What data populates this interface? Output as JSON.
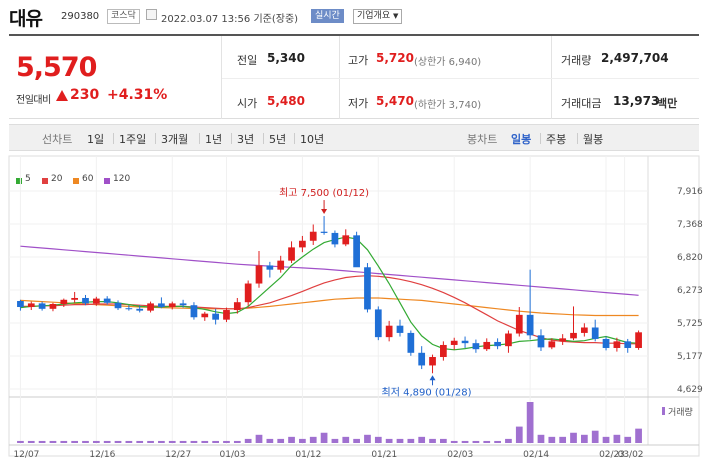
{
  "header": {
    "name": "대유",
    "code": "290380",
    "market": "코스닥",
    "datetime": "2022.03.07 13:56",
    "basis": "기준(장중)",
    "live_label": "실시간",
    "overview_label": "기업개요"
  },
  "quote": {
    "price": "5,570",
    "change_label": "전일대비",
    "change_value": "230",
    "change_pct": "+4.31%",
    "stats": {
      "prev_close": {
        "label": "전일",
        "value": "5,340"
      },
      "open": {
        "label": "시가",
        "value": "5,480"
      },
      "high": {
        "label": "고가",
        "value": "5,720",
        "sub": "(상한가 6,940)"
      },
      "low": {
        "label": "저가",
        "value": "5,470",
        "sub": "(하한가 3,740)"
      },
      "volume": {
        "label": "거래량",
        "value": "2,497,704"
      },
      "amount": {
        "label": "거래대금",
        "value": "13,973",
        "unit": "백만"
      }
    }
  },
  "period_bar": {
    "line_label": "선차트",
    "line_items": [
      "1일",
      "1주일",
      "3개월",
      "1년",
      "3년",
      "5년",
      "10년"
    ],
    "candle_label": "봉차트",
    "candle_items": [
      "일봉",
      "주봉",
      "월봉"
    ],
    "active_candle": "일봉"
  },
  "colors": {
    "up": "#e01e1e",
    "down": "#1f6fd6",
    "ma5": "#33aa33",
    "ma20": "#e04040",
    "ma60": "#ee8822",
    "ma120": "#a050c8",
    "volume": "#a070d0",
    "accent": "#2f63c9"
  },
  "chart_data": {
    "type": "candlestick",
    "legend": [
      "5",
      "20",
      "60",
      "120"
    ],
    "y_ticks": [
      "7,916",
      "7,368",
      "6,820",
      "6,273",
      "5,725",
      "5,177",
      "4,629"
    ],
    "ylim": [
      4629,
      7916
    ],
    "x_ticks": [
      "12/07",
      "12/16",
      "12/27",
      "01/03",
      "01/12",
      "01/21",
      "02/03",
      "02/14",
      "02/23",
      "03/02"
    ],
    "volume_label": "거래량",
    "annotations": {
      "high": {
        "text": "최고 7,500 (01/12)",
        "value": 7500
      },
      "low": {
        "text": "최저 4,890 (01/28)",
        "value": 4890
      }
    },
    "candles": [
      [
        6090,
        6110,
        5930,
        5990
      ],
      [
        5990,
        6080,
        5940,
        6050
      ],
      [
        6050,
        6080,
        5930,
        5960
      ],
      [
        5960,
        6060,
        5920,
        6040
      ],
      [
        6040,
        6130,
        5990,
        6110
      ],
      [
        6110,
        6240,
        6060,
        6140
      ],
      [
        6140,
        6190,
        6020,
        6050
      ],
      [
        6050,
        6160,
        6010,
        6130
      ],
      [
        6130,
        6170,
        6030,
        6060
      ],
      [
        6060,
        6100,
        5940,
        5970
      ],
      [
        5970,
        6020,
        5930,
        5960
      ],
      [
        5960,
        6020,
        5900,
        5930
      ],
      [
        5930,
        6080,
        5900,
        6050
      ],
      [
        6050,
        6150,
        5970,
        5990
      ],
      [
        5990,
        6080,
        5950,
        6050
      ],
      [
        6050,
        6110,
        5980,
        6020
      ],
      [
        6020,
        6070,
        5780,
        5820
      ],
      [
        5820,
        5910,
        5760,
        5880
      ],
      [
        5880,
        5960,
        5700,
        5780
      ],
      [
        5780,
        5980,
        5740,
        5940
      ],
      [
        5940,
        6140,
        5880,
        6070
      ],
      [
        6070,
        6430,
        6010,
        6380
      ],
      [
        6380,
        6920,
        6310,
        6680
      ],
      [
        6680,
        6740,
        6480,
        6610
      ],
      [
        6610,
        6840,
        6560,
        6760
      ],
      [
        6760,
        7080,
        6720,
        6980
      ],
      [
        6980,
        7170,
        6900,
        7090
      ],
      [
        7090,
        7360,
        7020,
        7240
      ],
      [
        7240,
        7500,
        7190,
        7220
      ],
      [
        7220,
        7260,
        6980,
        7030
      ],
      [
        7030,
        7280,
        7000,
        7180
      ],
      [
        7180,
        7240,
        6990,
        6650
      ],
      [
        6650,
        6720,
        5900,
        5950
      ],
      [
        5950,
        6000,
        5440,
        5490
      ],
      [
        5490,
        5760,
        5420,
        5680
      ],
      [
        5680,
        5780,
        5500,
        5560
      ],
      [
        5560,
        5600,
        5180,
        5230
      ],
      [
        5230,
        5340,
        4960,
        5020
      ],
      [
        5020,
        5200,
        4890,
        5160
      ],
      [
        5160,
        5420,
        5100,
        5360
      ],
      [
        5360,
        5480,
        5280,
        5430
      ],
      [
        5430,
        5500,
        5310,
        5390
      ],
      [
        5390,
        5450,
        5230,
        5290
      ],
      [
        5290,
        5470,
        5260,
        5410
      ],
      [
        5410,
        5470,
        5290,
        5340
      ],
      [
        5340,
        5600,
        5230,
        5550
      ],
      [
        5550,
        5990,
        5500,
        5860
      ],
      [
        5860,
        6610,
        5450,
        5520
      ],
      [
        5520,
        5620,
        5260,
        5320
      ],
      [
        5320,
        5470,
        5290,
        5420
      ],
      [
        5420,
        5540,
        5360,
        5470
      ],
      [
        5470,
        6000,
        5440,
        5560
      ],
      [
        5560,
        5720,
        5500,
        5650
      ],
      [
        5650,
        5780,
        5420,
        5460
      ],
      [
        5460,
        5500,
        5270,
        5310
      ],
      [
        5310,
        5480,
        5250,
        5420
      ],
      [
        5420,
        5460,
        5230,
        5310
      ],
      [
        5310,
        5600,
        5280,
        5570
      ]
    ],
    "ma5": [
      5980,
      6000,
      6010,
      6020,
      6040,
      6060,
      6070,
      6080,
      6080,
      6060,
      6030,
      6000,
      5990,
      5990,
      6000,
      6000,
      5980,
      5950,
      5910,
      5880,
      5900,
      6000,
      6160,
      6320,
      6480,
      6680,
      6820,
      6950,
      7060,
      7110,
      7150,
      7120,
      6940,
      6670,
      6380,
      6060,
      5740,
      5510,
      5370,
      5300,
      5280,
      5300,
      5330,
      5350,
      5360,
      5380,
      5420,
      5430,
      5450,
      5460,
      5440,
      5420,
      5430,
      5470,
      5500,
      5450,
      5400,
      5390
    ],
    "ma20": [
      6000,
      6000,
      6010,
      6010,
      6020,
      6030,
      6030,
      6040,
      6040,
      6040,
      6030,
      6020,
      6010,
      6000,
      6000,
      6000,
      5990,
      5980,
      5970,
      5960,
      5960,
      5980,
      6020,
      6060,
      6120,
      6180,
      6250,
      6320,
      6390,
      6440,
      6480,
      6500,
      6510,
      6500,
      6480,
      6450,
      6410,
      6360,
      6300,
      6230,
      6150,
      6060,
      5960,
      5860,
      5760,
      5680,
      5600,
      5540,
      5480,
      5440,
      5420,
      5410,
      5400,
      5400,
      5390,
      5390,
      5380,
      5380
    ],
    "ma60": [
      6100,
      6090,
      6080,
      6070,
      6060,
      6050,
      6040,
      6030,
      6020,
      6010,
      6000,
      5990,
      5985,
      5980,
      5975,
      5970,
      5965,
      5960,
      5960,
      5960,
      5960,
      5970,
      5985,
      6000,
      6020,
      6040,
      6060,
      6080,
      6100,
      6120,
      6130,
      6140,
      6140,
      6140,
      6130,
      6120,
      6110,
      6100,
      6080,
      6060,
      6040,
      6020,
      6000,
      5980,
      5960,
      5940,
      5920,
      5905,
      5890,
      5880,
      5870,
      5860,
      5855,
      5850,
      5850,
      5850,
      5850,
      5850
    ],
    "ma120": [
      7000,
      6985,
      6970,
      6955,
      6940,
      6925,
      6910,
      6895,
      6880,
      6865,
      6850,
      6835,
      6820,
      6805,
      6790,
      6775,
      6760,
      6745,
      6730,
      6715,
      6700,
      6690,
      6680,
      6670,
      6660,
      6650,
      6640,
      6630,
      6620,
      6605,
      6590,
      6575,
      6560,
      6545,
      6530,
      6515,
      6500,
      6485,
      6470,
      6455,
      6440,
      6425,
      6410,
      6395,
      6380,
      6365,
      6350,
      6335,
      6320,
      6305,
      6290,
      6275,
      6260,
      6245,
      6230,
      6215,
      6200,
      6185
    ],
    "volume": [
      1,
      1,
      1,
      1,
      1,
      1,
      1,
      1,
      1,
      1,
      1,
      1,
      1,
      1,
      1,
      1,
      1,
      1,
      1,
      1,
      1,
      2,
      4,
      2,
      2,
      3,
      2,
      3,
      5,
      2,
      3,
      2,
      4,
      3,
      2,
      2,
      2,
      3,
      2,
      2,
      1,
      1,
      1,
      1,
      1,
      2,
      8,
      20,
      4,
      3,
      3,
      5,
      4,
      6,
      3,
      4,
      3,
      7
    ]
  }
}
